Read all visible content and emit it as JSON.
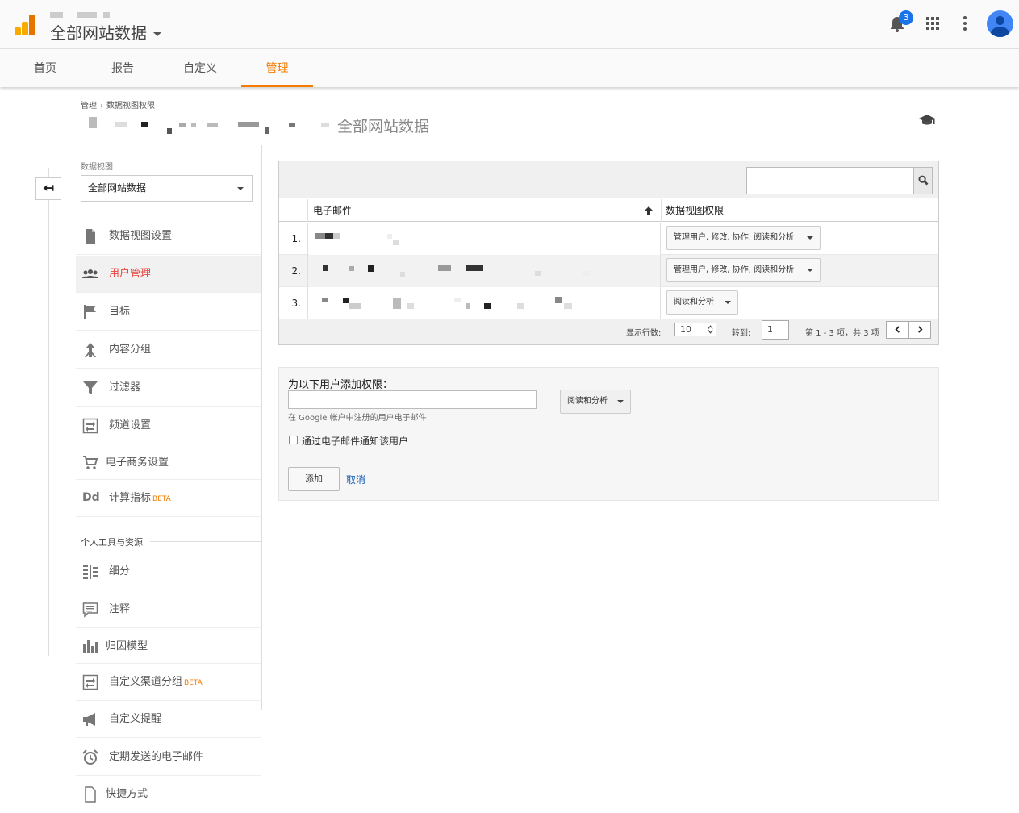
{
  "header": {
    "view_title": "全部网站数据",
    "notification_count": "3"
  },
  "tabs": [
    {
      "label": "首页"
    },
    {
      "label": "报告"
    },
    {
      "label": "自定义"
    },
    {
      "label": "管理"
    }
  ],
  "breadcrumb": {
    "root": "管理",
    "current": "数据视图权限"
  },
  "path_title": "全部网站数据",
  "left_panel": {
    "view_label": "数据视图",
    "view_select": "全部网站数据",
    "items": [
      {
        "label": "数据视图设置",
        "icon": "document-icon"
      },
      {
        "label": "用户管理",
        "icon": "people-icon"
      },
      {
        "label": "目标",
        "icon": "flag-icon"
      },
      {
        "label": "内容分组",
        "icon": "content-grouping-icon"
      },
      {
        "label": "过滤器",
        "icon": "filter-icon"
      },
      {
        "label": "频道设置",
        "icon": "channel-icon"
      },
      {
        "label": "电子商务设置",
        "icon": "cart-icon"
      },
      {
        "label": "计算指标",
        "icon": "dd-icon",
        "beta": "BETA"
      }
    ],
    "personal_header": "个人工具与资源",
    "personal_items": [
      {
        "label": "细分",
        "icon": "segments-icon"
      },
      {
        "label": "注释",
        "icon": "annotation-icon"
      },
      {
        "label": "归因模型",
        "icon": "attribution-icon"
      },
      {
        "label": "自定义渠道分组",
        "icon": "channel-icon",
        "beta": "BETA"
      },
      {
        "label": "自定义提醒",
        "icon": "megaphone-icon"
      },
      {
        "label": "定期发送的电子邮件",
        "icon": "alarm-clock-icon"
      },
      {
        "label": "快捷方式",
        "icon": "shortcut-icon"
      }
    ]
  },
  "table": {
    "col_email": "电子邮件",
    "col_perm": "数据视图权限",
    "rows": [
      {
        "num": "1.",
        "perm": "管理用户, 修改, 协作, 阅读和分析"
      },
      {
        "num": "2.",
        "perm": "管理用户, 修改, 协作, 阅读和分析"
      },
      {
        "num": "3.",
        "perm": "阅读和分析"
      }
    ],
    "rows_label": "显示行数:",
    "rows_value": "10",
    "goto_label": "转到:",
    "goto_value": "1",
    "range_text": "第 1 - 3 项，共 3 项"
  },
  "add_form": {
    "header": "为以下用户添加权限：",
    "hint": "在 Google 帐户中注册的用户电子邮件",
    "perm_select": "阅读和分析",
    "notify_label": "通过电子邮件通知该用户",
    "add_button": "添加",
    "cancel_link": "取消"
  },
  "colors": {
    "accent": "#f57c00",
    "active_menu": "#e8453c",
    "link": "#1a5fb4"
  }
}
